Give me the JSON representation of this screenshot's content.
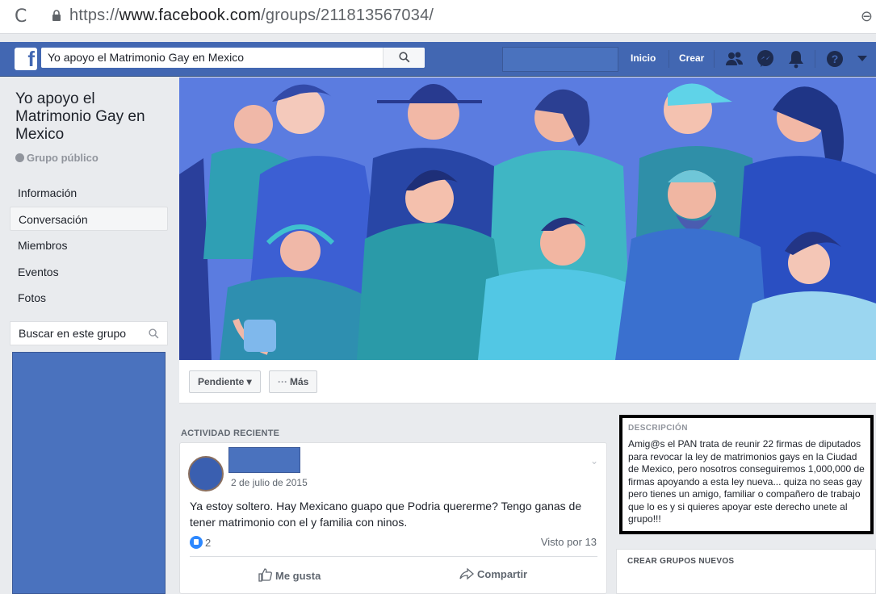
{
  "browser": {
    "url_scheme": "https://",
    "url_host": "www.facebook.com",
    "url_path": "/groups/211813567034/",
    "reload_glyph": "C",
    "profile_glyph": "⊖"
  },
  "topbar": {
    "logo_letter": "f",
    "search_value": "Yo apoyo el Matrimonio Gay en Mexico",
    "home_label": "Inicio",
    "create_label": "Crear"
  },
  "sidebar": {
    "group_name": "Yo apoyo el Matrimonio Gay en Mexico",
    "group_type": "Grupo público",
    "items": [
      {
        "label": "Información"
      },
      {
        "label": "Conversación"
      },
      {
        "label": "Miembros"
      },
      {
        "label": "Eventos"
      },
      {
        "label": "Fotos"
      }
    ],
    "search_placeholder": "Buscar en este grupo"
  },
  "actions": {
    "pending_label": "Pendiente ▾",
    "more_label": "Más",
    "more_dots": "···"
  },
  "activity": {
    "header": "ACTIVIDAD RECIENTE",
    "post": {
      "date": "2 de julio de 2015",
      "text": "Ya estoy soltero. Hay Mexicano guapo que Podria quererme? Tengo ganas de tener matrimonio con el y familia con ninos.",
      "like_count": "2",
      "seen": "Visto por 13",
      "like_label": "Me gusta",
      "share_label": "Compartir"
    }
  },
  "description": {
    "header": "DESCRIPCIÓN",
    "text": "Amig@s el PAN trata de reunir 22 firmas de diputados para revocar la ley de matrimonios gays en la Ciudad de Mexico, pero nosotros conseguiremos 1,000,000 de firmas apoyando a esta ley nueva... quiza no seas gay pero tienes un amigo, familiar o compañero de trabajo que lo es y si quieres apoyar este derecho unete al grupo!!!"
  },
  "new_groups": {
    "header": "CREAR GRUPOS NUEVOS"
  },
  "colors": {
    "fb_blue": "#4267b2",
    "background": "#e9ebee",
    "cover_blue": "#5b7ce0"
  }
}
